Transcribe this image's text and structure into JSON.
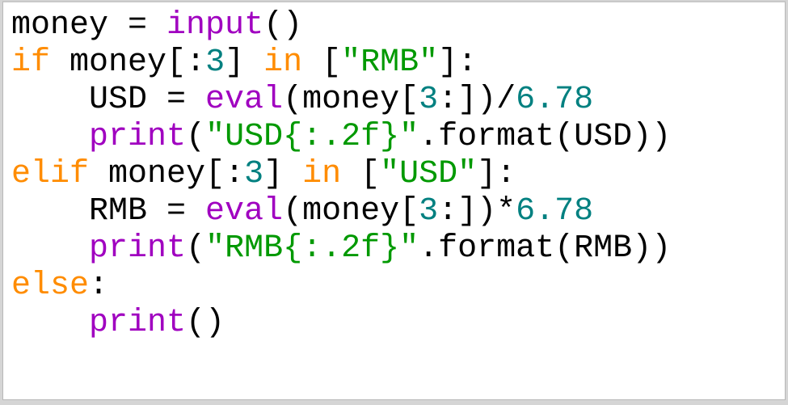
{
  "code": {
    "l1": {
      "id_money": "money",
      "assign": " = ",
      "fn_input": "input",
      "paren": "()"
    },
    "l2": {
      "kw_if": "if",
      "sp": " ",
      "id_money": "money",
      "slice": "[:",
      "num3": "3",
      "slice_end": "] ",
      "kw_in": "in",
      "sp2": " ",
      "lb": "[",
      "str_rmb": "\"RMB\"",
      "rb": "]:"
    },
    "l3": {
      "indent": "    ",
      "id_usd": "USD",
      "assign": " = ",
      "fn_eval": "eval",
      "lp": "(",
      "id_money": "money",
      "slice": "[",
      "num3": "3",
      "slice_end": ":])/",
      "num": "6.78"
    },
    "l4": {
      "indent": "    ",
      "fn_print": "print",
      "lp": "(",
      "str": "\"USD{:.2f}\"",
      "dot": ".",
      "fmt": "format",
      "lp2": "(",
      "id_usd": "USD",
      "rp": "))"
    },
    "l5": {
      "kw_elif": "elif",
      "sp": " ",
      "id_money": "money",
      "slice": "[:",
      "num3": "3",
      "slice_end": "] ",
      "kw_in": "in",
      "sp2": " ",
      "lb": "[",
      "str_usd": "\"USD\"",
      "rb": "]:"
    },
    "l6": {
      "indent": "    ",
      "id_rmb": "RMB",
      "assign": " = ",
      "fn_eval": "eval",
      "lp": "(",
      "id_money": "money",
      "slice": "[",
      "num3": "3",
      "slice_end": ":])*",
      "num": "6.78"
    },
    "l7": {
      "indent": "    ",
      "fn_print": "print",
      "lp": "(",
      "str": "\"RMB{:.2f}\"",
      "dot": ".",
      "fmt": "format",
      "lp2": "(",
      "id_rmb": "RMB",
      "rp": "))"
    },
    "l8": {
      "kw_else": "else",
      "colon": ":"
    },
    "l9": {
      "indent": "    ",
      "fn_print": "print",
      "paren": "()"
    }
  },
  "colors": {
    "keyword": "#ff8c00",
    "builtin": "#a000c0",
    "string": "#009900",
    "number": "#008080",
    "text": "#000000",
    "bg": "#ffffff"
  }
}
